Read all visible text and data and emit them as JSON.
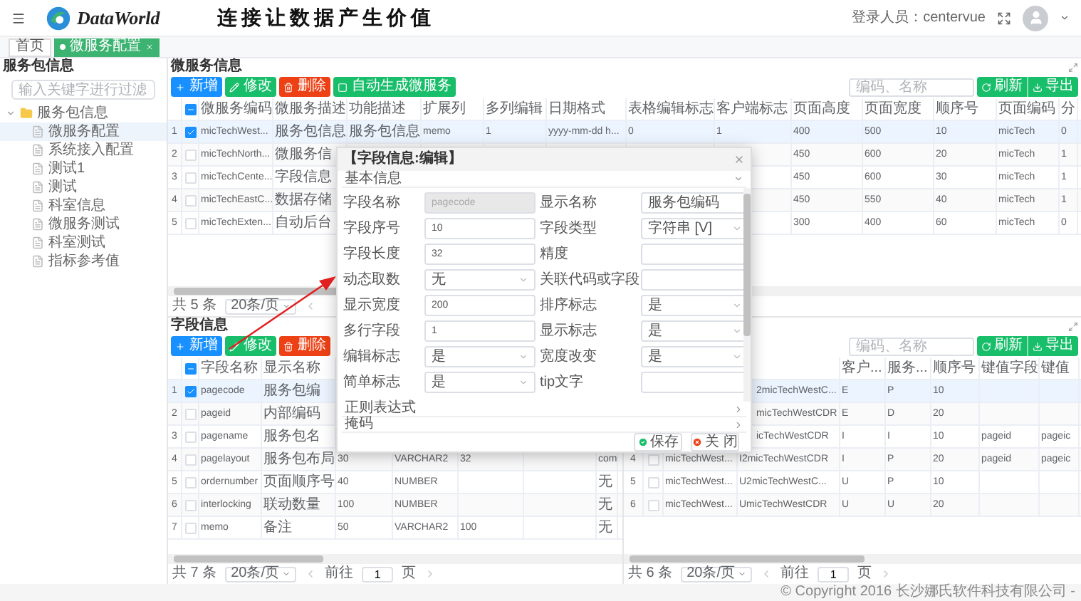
{
  "header": {
    "logo_text": "DataWorld",
    "slogan": "连接让数据产生价值",
    "login": "登录人员：centervue"
  },
  "tabs": [
    {
      "label": "首页",
      "selected": false,
      "closable": false
    },
    {
      "label": "微服务配置",
      "selected": true,
      "closable": true
    }
  ],
  "sidebar": {
    "title": "服务包信息",
    "search": {
      "placeholder": "输入关键字进行过滤"
    },
    "tree": [
      {
        "label": "服务包信息",
        "expanded": true,
        "selected": false,
        "children": [
          {
            "label": "微服务配置",
            "selected": true
          },
          {
            "label": "系统接入配置",
            "selected": false
          },
          {
            "label": "测试1",
            "selected": false
          },
          {
            "label": "测试",
            "selected": false
          },
          {
            "label": "科室信息",
            "selected": false
          },
          {
            "label": "微服务测试",
            "selected": false
          },
          {
            "label": "科室测试",
            "selected": false
          },
          {
            "label": "指标参考值",
            "selected": false
          }
        ]
      }
    ]
  },
  "service_panel": {
    "title": "微服务信息",
    "buttons": [
      {
        "label": "新增",
        "kind": "add"
      },
      {
        "label": "修改",
        "kind": "edit"
      },
      {
        "label": "删除",
        "kind": "delete"
      },
      {
        "label": "自动生成微服务",
        "kind": "generate"
      }
    ],
    "search": {
      "placeholder": "编码、名称"
    },
    "tools": [
      {
        "label": "刷新",
        "kind": "refresh"
      },
      {
        "label": "导出",
        "kind": "export"
      }
    ],
    "table": {
      "header_indeterminate": true,
      "columns": [
        "微服务编码",
        "微服务描述",
        "功能描述",
        "扩展列",
        "多列编辑",
        "日期格式",
        "表格编辑标志",
        "客户端标志",
        "页面高度",
        "页面宽度",
        "顺序号",
        "页面编码",
        "分"
      ],
      "rows": [
        {
          "index": "1",
          "selected": true,
          "cells": [
            "micTechWest...",
            "服务包信息",
            "服务包信息",
            "memo",
            "1",
            "yyyy-mm-dd h...",
            "0",
            "1",
            "400",
            "500",
            "10",
            "micTech",
            "0"
          ]
        },
        {
          "index": "2",
          "selected": false,
          "cells": [
            "micTechNorth...",
            "微服务信",
            null,
            null,
            null,
            null,
            null,
            null,
            "450",
            "600",
            "20",
            "micTech",
            "1"
          ]
        },
        {
          "index": "3",
          "selected": false,
          "cells": [
            "micTechCente...",
            "字段信息",
            null,
            null,
            null,
            null,
            null,
            null,
            "450",
            "600",
            "30",
            "micTech",
            "1"
          ]
        },
        {
          "index": "4",
          "selected": false,
          "cells": [
            "micTechEastC...",
            "数据存储",
            null,
            null,
            null,
            null,
            null,
            null,
            "450",
            "550",
            "40",
            "micTech",
            "1"
          ]
        },
        {
          "index": "5",
          "selected": false,
          "cells": [
            "micTechExten...",
            "自动后台",
            null,
            null,
            null,
            null,
            null,
            null,
            "300",
            "400",
            "60",
            "micTech",
            "0"
          ]
        }
      ]
    },
    "pager": {
      "total": "共 5 条",
      "size": "20条/页"
    }
  },
  "field_panel": {
    "title": "字段信息",
    "buttons": [
      {
        "label": "新增",
        "kind": "add"
      },
      {
        "label": "修改",
        "kind": "edit"
      },
      {
        "label": "删除",
        "kind": "delete"
      }
    ],
    "search": {
      "placeholder": "编码、名称"
    },
    "tools": [
      {
        "label": "刷新",
        "kind": "refresh"
      },
      {
        "label": "导出",
        "kind": "export"
      }
    ],
    "left_table": {
      "header_indeterminate": true,
      "columns": [
        "字段名称",
        "显示名称",
        null,
        null,
        null,
        null,
        null
      ],
      "rows": [
        {
          "index": "1",
          "selected": true,
          "cells": [
            "pagecode",
            "服务包编",
            null,
            null,
            null,
            null,
            null
          ]
        },
        {
          "index": "2",
          "selected": false,
          "cells": [
            "pageid",
            "内部编码",
            null,
            null,
            null,
            null,
            null
          ]
        },
        {
          "index": "3",
          "selected": false,
          "cells": [
            "pagename",
            "服务包名",
            null,
            null,
            null,
            null,
            null
          ]
        },
        {
          "index": "4",
          "selected": false,
          "cells": [
            "pagelayout",
            "服务包布局",
            "30",
            "VARCHAR2",
            "32",
            null,
            "com"
          ]
        },
        {
          "index": "5",
          "selected": false,
          "cells": [
            "ordernumber",
            "页面顺序号",
            "40",
            "NUMBER",
            null,
            null,
            "无"
          ]
        },
        {
          "index": "6",
          "selected": false,
          "cells": [
            "interlocking",
            "联动数量",
            "100",
            "NUMBER",
            null,
            null,
            "无"
          ]
        },
        {
          "index": "7",
          "selected": false,
          "cells": [
            "memo",
            "备注",
            "50",
            "VARCHAR2",
            "100",
            null,
            "无"
          ]
        }
      ]
    },
    "left_pager": {
      "total": "共 7 条",
      "size": "20条/页",
      "goto": "前往",
      "page": "1",
      "unit": "页"
    },
    "right_table": {
      "columns": [
        null,
        null,
        "客户...",
        "服务...",
        "顺序号",
        "键值字段",
        "键值"
      ],
      "rows": [
        {
          "index": null,
          "selected": true,
          "cells": [
            null,
            "2micTechWestC...",
            "E",
            "P",
            "10",
            null,
            null
          ]
        },
        {
          "index": null,
          "selected": false,
          "cells": [
            null,
            "micTechWestCDR",
            "E",
            "D",
            "20",
            null,
            null
          ]
        },
        {
          "index": null,
          "selected": false,
          "cells": [
            null,
            "icTechWestCDR",
            "I",
            "I",
            "10",
            "pageid",
            "pageic"
          ]
        },
        {
          "index": "4",
          "selected": false,
          "cells": [
            "micTechWest...",
            "I2micTechWestCDR",
            "I",
            "P",
            "20",
            "pageid",
            "pageic"
          ]
        },
        {
          "index": "5",
          "selected": false,
          "cells": [
            "micTechWest...",
            "U2micTechWestC...",
            "U",
            "P",
            "10",
            null,
            null
          ]
        },
        {
          "index": "6",
          "selected": false,
          "cells": [
            "micTechWest...",
            "UmicTechWestCDR",
            "U",
            "U",
            "20",
            null,
            null
          ]
        }
      ]
    },
    "right_pager": {
      "total": "共 6 条",
      "size": "20条/页",
      "goto": "前往",
      "page": "1",
      "unit": "页"
    }
  },
  "dialog": {
    "title": "【字段信息:编辑】",
    "section": "基本信息",
    "fields": [
      {
        "label": "字段名称",
        "value": "pagecode",
        "kind": "input",
        "disabled": true
      },
      {
        "label": "显示名称",
        "value": "服务包编码",
        "kind": "input",
        "disabled": false
      },
      {
        "label": "字段序号",
        "value": "10",
        "kind": "input",
        "disabled": false
      },
      {
        "label": "字段类型",
        "value": "字符串 [V]",
        "kind": "select",
        "disabled": false
      },
      {
        "label": "字段长度",
        "value": "32",
        "kind": "input",
        "disabled": false
      },
      {
        "label": "精度",
        "kind": "input",
        "disabled": false
      },
      {
        "label": "动态取数",
        "value": "无",
        "kind": "select",
        "disabled": false
      },
      {
        "label": "关联代码或字段",
        "kind": "input",
        "disabled": false
      },
      {
        "label": "显示宽度",
        "value": "200",
        "kind": "input",
        "disabled": false
      },
      {
        "label": "排序标志",
        "value": "是",
        "kind": "select",
        "disabled": false
      },
      {
        "label": "多行字段",
        "value": "1",
        "kind": "input",
        "disabled": false
      },
      {
        "label": "显示标志",
        "value": "是",
        "kind": "select",
        "disabled": false
      },
      {
        "label": "编辑标志",
        "value": "是",
        "kind": "select",
        "disabled": false
      },
      {
        "label": "宽度改变",
        "value": "是",
        "kind": "select",
        "disabled": false
      },
      {
        "label": "简单标志",
        "value": "是",
        "kind": "select",
        "disabled": false
      },
      {
        "label": "tip文字",
        "kind": "input",
        "disabled": false
      }
    ],
    "collapsed": [
      "正则表达式",
      "掩码"
    ],
    "actions": [
      {
        "label": "保存",
        "kind": "save"
      },
      {
        "label": "关 闭",
        "kind": "close"
      }
    ]
  },
  "footer": "© Copyright 2016 长沙娜氏软件科技有限公司 -"
}
